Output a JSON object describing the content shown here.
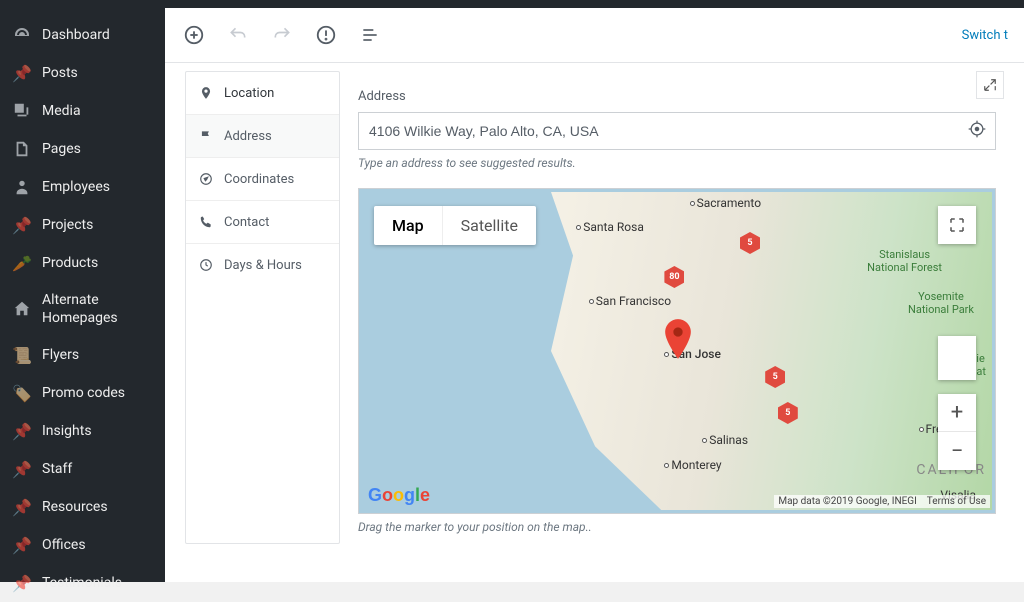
{
  "topLink": "Switch t",
  "sidebar": {
    "items": [
      {
        "icon": "dashboard",
        "label": "Dashboard"
      },
      {
        "icon": "pin",
        "label": "Posts"
      },
      {
        "icon": "media",
        "label": "Media"
      },
      {
        "icon": "pages",
        "label": "Pages"
      },
      {
        "icon": "person",
        "label": "Employees"
      },
      {
        "icon": "pin",
        "label": "Projects"
      },
      {
        "icon": "carrot",
        "label": "Products"
      },
      {
        "icon": "home",
        "label": "Alternate Homepages"
      },
      {
        "icon": "scroll",
        "label": "Flyers"
      },
      {
        "icon": "certificate",
        "label": "Promo codes"
      },
      {
        "icon": "pin",
        "label": "Insights"
      },
      {
        "icon": "pin",
        "label": "Staff"
      },
      {
        "icon": "pin",
        "label": "Resources"
      },
      {
        "icon": "pin",
        "label": "Offices"
      },
      {
        "icon": "pin",
        "label": "Testimonials"
      }
    ]
  },
  "metaTabs": [
    {
      "icon": "location",
      "label": "Location"
    },
    {
      "icon": "flag",
      "label": "Address",
      "active": true
    },
    {
      "icon": "compass",
      "label": "Coordinates"
    },
    {
      "icon": "phone",
      "label": "Contact"
    },
    {
      "icon": "clock",
      "label": "Days & Hours"
    }
  ],
  "addressField": {
    "label": "Address",
    "value": "4106 Wilkie Way, Palo Alto, CA, USA",
    "hint": "Type an address to see suggested results."
  },
  "map": {
    "typeMap": "Map",
    "typeSat": "Satellite",
    "hint": "Drag the marker to your position on the map..",
    "attribution": "Map data ©2019 Google, INEGI",
    "terms": "Terms of Use",
    "cities": {
      "sacramento": "Sacramento",
      "santaRosa": "Santa Rosa",
      "sanFrancisco": "San Francisco",
      "sanJose": "San Jose",
      "salinas": "Salinas",
      "monterey": "Monterey",
      "fresno": "Fresno",
      "visalia": "Visalia",
      "califor": "CALIFOR"
    },
    "parks": {
      "stan": "Stanislaus\nNational Forest",
      "yos": "Yosemite\nNational Park",
      "sie": "Sie\nNat"
    },
    "shields": {
      "i5": "5",
      "i80": "80"
    }
  }
}
